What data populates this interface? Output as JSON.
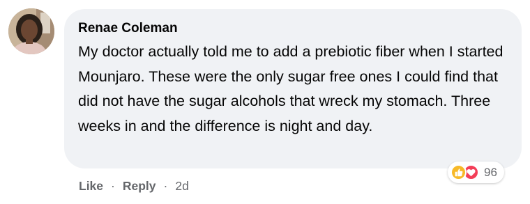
{
  "comment": {
    "author": "Renae Coleman",
    "text": "My doctor actually told me to add a prebiotic fiber when I started Mounjaro. These were the only sugar free ones I could find that did not have the sugar alcohols that wreck my stomach. Three weeks in and the difference is night and day.",
    "avatar_icon": "profile-photo",
    "bubble_color": "#f0f2f5",
    "reactions": {
      "types": [
        "like-icon",
        "heart-icon"
      ],
      "count": "96"
    },
    "actions": {
      "like_label": "Like",
      "reply_label": "Reply",
      "separator": "·",
      "timestamp": "2d"
    }
  }
}
